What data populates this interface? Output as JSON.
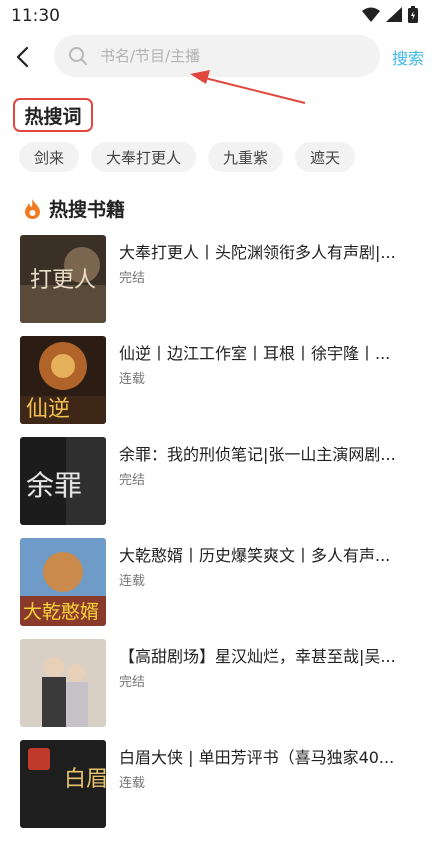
{
  "status_bar": {
    "time": "11:30"
  },
  "search": {
    "placeholder": "书名/节目/主播",
    "button_label": "搜索"
  },
  "hot_words": {
    "title": "热搜词",
    "chips": [
      "剑来",
      "大奉打更人",
      "九重紫",
      "遮天"
    ]
  },
  "hot_books": {
    "title": "热搜书籍",
    "items": [
      {
        "title": "大奉打更人丨头陀渊领衔多人有声剧|...",
        "status": "完结",
        "cover_text": "打更人"
      },
      {
        "title": "仙逆丨边江工作室丨耳根丨徐宇隆丨...",
        "status": "连载",
        "cover_text": "仙逆"
      },
      {
        "title": "余罪：我的刑侦笔记|张一山主演网剧...",
        "status": "完结",
        "cover_text": "余罪"
      },
      {
        "title": "大乾憨婿丨历史爆笑爽文丨多人有声...",
        "status": "连载",
        "cover_text": "大乾憨婿"
      },
      {
        "title": "【高甜剧场】星汉灿烂，幸甚至哉|吴...",
        "status": "完结",
        "cover_text": ""
      },
      {
        "title": "白眉大侠 | 单田芳评书（喜马独家40...",
        "status": "连载",
        "cover_text": "白眉"
      }
    ]
  },
  "colors": {
    "accent": "#3db9e6",
    "annotation_red": "#e0473e",
    "flame": "#f07a22"
  }
}
